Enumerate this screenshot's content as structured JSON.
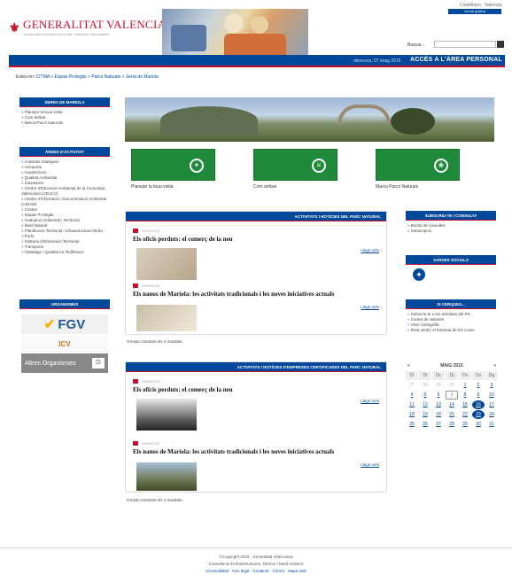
{
  "header": {
    "lang": "Castellano · Valencià",
    "top_btn": "Versió gràfica",
    "logo_name": "GENERALITAT VALENCIANA",
    "logo_sub": "CONSELLERIA D'INFRAESTRUCTURES, TERRITORI I MEDI AMBIENT",
    "search_label": "Buscar...",
    "date": "dimecres, 07 maig 2015",
    "access": "ACCÉS A L'ÀREA PERSONAL"
  },
  "breadcrumb": {
    "prefix": "Esteu en:",
    "path": "CITMA > Espais Protegits > Parcs Naturals > Serra de Mariola"
  },
  "left": {
    "park_title": "SERRA DE MARIOLA",
    "park_items": [
      "Planejar la teua visita",
      "Com arribar",
      "Marca Parcs Naturals"
    ],
    "areas_title": "ÀREES D'ACTIVITAT",
    "areas_items": [
      "Activitats nàutiques",
      "Aeroports",
      "Arquitectura",
      "Qualitat Ambiental",
      "Carreteres",
      "Centre d'Educació Ambiental de la Comunitat Valenciana (CEACV)",
      "Centre d'Informació i Documentació Ambiental (CIDAM)",
      "Costes",
      "Espais Protegits",
      "Avaluació Ambiental i Territorial",
      "Medi Natural",
      "Planificació Territorial i Infraestructura Verda",
      "Ports",
      "Sistema d'Informació Territorial",
      "Transports",
      "Habitatge i Qualitat en l'Edificació"
    ],
    "orgs_title": "ORGANISMES",
    "org_fgv": "FGV",
    "org_icv": "ICV",
    "altres": "Altres Organismes"
  },
  "tiles": [
    {
      "label": "Planejar la teua visita",
      "icon": "compass-icon"
    },
    {
      "label": "Com arribar",
      "icon": "signpost-icon"
    },
    {
      "label": "Marca Parcs Naturals",
      "icon": "leaf-icon"
    }
  ],
  "news1": {
    "title": "ACTIVITATS I NOTÍCIES DEL PARC NATURAL",
    "items": [
      {
        "date": "10/02/2015",
        "title": "Els oficis perduts: el comerç de la neu",
        "more": "Llegir més"
      },
      {
        "date": "23/02/2015",
        "title": "Els nanos de Mariola: les activitats tradicionals i les noves iniciatives actuals",
        "more": "Llegir més"
      }
    ],
    "count": "S'estan mostrant els 2 resultats."
  },
  "news2": {
    "title": "ACTIVITATS I NOTÍCIES D'EMPRESES CERTIFICADES DEL PARC NATURAL",
    "items": [
      {
        "date": "10/02/2015",
        "title": "Els oficis perduts: el comerç de la neu",
        "more": "Llegir més"
      },
      {
        "date": "23/02/2015",
        "title": "Els nanos de Mariola: les activitats tradicionals i les noves iniciatives actuals",
        "more": "Llegir més"
      }
    ],
    "count": "S'estan mostrant els 2 resultats."
  },
  "right": {
    "subs_title": "SUBSCRIU-TE I CONSULTA",
    "subs_items": [
      "Bústia de consultes",
      "Subscripció"
    ],
    "social_title": "XARXES SOCIALS",
    "cerques_title": "SI CERQUES...",
    "cerques_items": [
      "Subscriu-te a les activitats del PN",
      "Centre de visitants",
      "Visor cartogràfic",
      "Ruta verda: el fontanar de les coves"
    ]
  },
  "calendar": {
    "month": "MAIG 2015",
    "prev": "«",
    "next": "»",
    "days": [
      "Dl",
      "Dt",
      "Dc",
      "Dj",
      "Dv",
      "Ds",
      "Dg"
    ],
    "weeks": [
      [
        "27",
        "28",
        "29",
        "30",
        "1",
        "2",
        "3"
      ],
      [
        "4",
        "5",
        "6",
        "7",
        "8",
        "9",
        "10"
      ],
      [
        "11",
        "12",
        "13",
        "14",
        "15",
        "16",
        "17"
      ],
      [
        "18",
        "19",
        "20",
        "21",
        "22",
        "23",
        "24"
      ],
      [
        "25",
        "26",
        "27",
        "28",
        "29",
        "30",
        "31"
      ]
    ]
  },
  "footer": {
    "copy": "©Copyright 2015 · Generalitat Valenciana",
    "dept": "Conselleria d'Infraestructures, Territori i Medi Ambient",
    "links": [
      "Accessibilitat",
      "Avís legal",
      "Contacte",
      "Correu",
      "Mapa web"
    ]
  }
}
